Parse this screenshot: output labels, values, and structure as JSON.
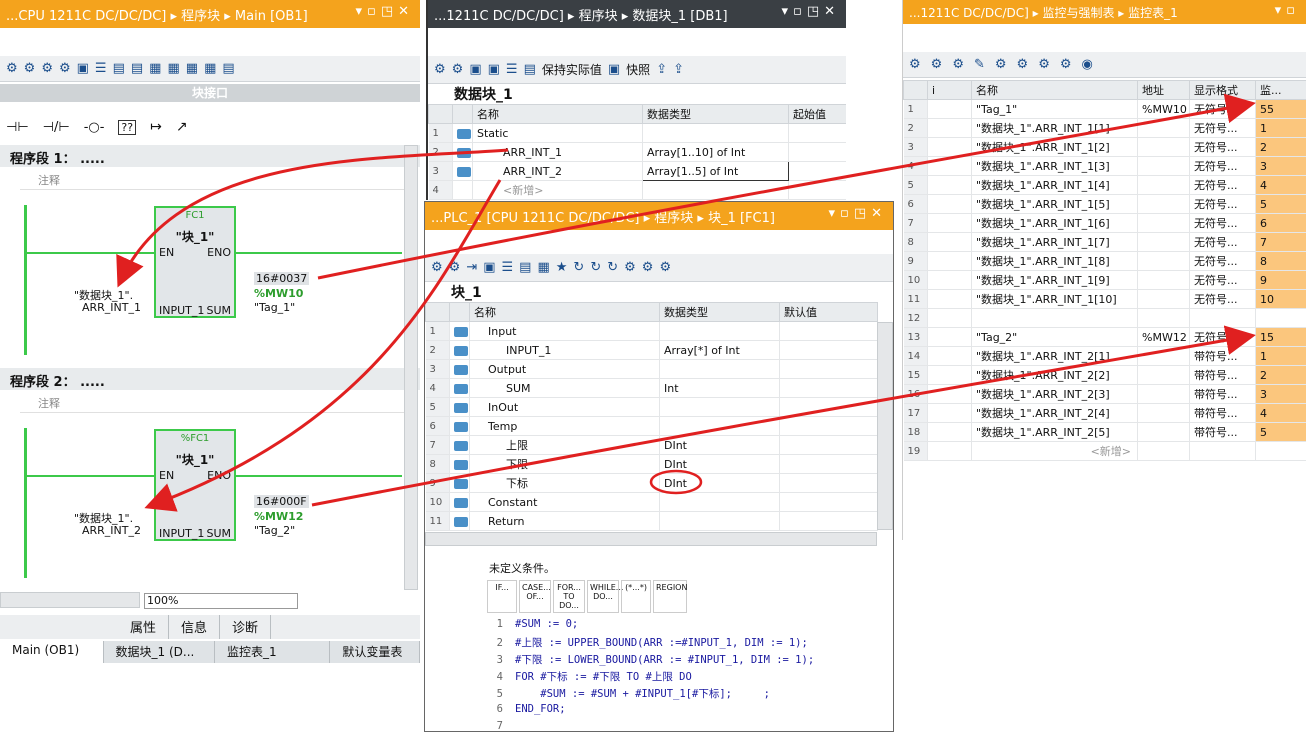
{
  "ob1": {
    "title": "...CPU 1211C DC/DC/DC] ▸ 程序块 ▸ Main [OB1]",
    "interface_bar": "块接口",
    "ladder_toolbar": [
      "⊣⊢",
      "⊣/⊢",
      "-○-",
      "??",
      "↦",
      "↗"
    ],
    "networks": [
      {
        "label": "程序段 1：  .....",
        "comment": "注释",
        "block_type": "FC1",
        "block_name": "\"块_1\"",
        "en": "EN",
        "eno": "ENO",
        "input_pin": "INPUT_1",
        "sum_pin": "SUM",
        "input_operand_1": "\"数据块_1\".",
        "input_operand_2": "ARR_INT_1",
        "out_hex": "16#0037",
        "out_addr": "%MW10",
        "out_tag": "\"Tag_1\""
      },
      {
        "label": "程序段 2：  .....",
        "comment": "注释",
        "block_type": "%FC1",
        "block_name": "\"块_1\"",
        "en": "EN",
        "eno": "ENO",
        "input_pin": "INPUT_1",
        "sum_pin": "SUM",
        "input_operand_1": "\"数据块_1\".",
        "input_operand_2": "ARR_INT_2",
        "out_hex": "16#000F",
        "out_addr": "%MW12",
        "out_tag": "\"Tag_2\""
      }
    ],
    "zoom": "100%",
    "bottom_tabs": [
      "属性",
      "信息",
      "诊断"
    ],
    "taskbar": [
      "Main (OB1)",
      "数据块_1 (D...",
      "监控表_1",
      "默认变量表"
    ]
  },
  "db1": {
    "title": "...1211C DC/DC/DC] ▸ 程序块 ▸ 数据块_1 [DB1]",
    "toolbar": {
      "keep_actual": "保持实际值",
      "snapshot": "快照"
    },
    "heading": "数据块_1",
    "columns": [
      "名称",
      "数据类型",
      "起始值"
    ],
    "rows": [
      {
        "n": "1",
        "name": "Static",
        "type": ""
      },
      {
        "n": "2",
        "name": "ARR_INT_1",
        "type": "Array[1..10] of Int"
      },
      {
        "n": "3",
        "name": "ARR_INT_2",
        "type": "Array[1..5] of Int"
      },
      {
        "n": "4",
        "name": "<新增>",
        "type": ""
      }
    ]
  },
  "fc1": {
    "title": "...PLC_1 [CPU 1211C DC/DC/DC] ▸ 程序块 ▸ 块_1 [FC1]",
    "heading": "块_1",
    "columns": [
      "名称",
      "数据类型",
      "默认值"
    ],
    "rows": [
      {
        "n": "1",
        "name": "Input",
        "type": ""
      },
      {
        "n": "2",
        "name": "INPUT_1",
        "type": "Array[*] of Int"
      },
      {
        "n": "3",
        "name": "Output",
        "type": ""
      },
      {
        "n": "4",
        "name": "SUM",
        "type": "Int"
      },
      {
        "n": "5",
        "name": "InOut",
        "type": ""
      },
      {
        "n": "6",
        "name": "Temp",
        "type": ""
      },
      {
        "n": "7",
        "name": "上限",
        "type": "DInt"
      },
      {
        "n": "8",
        "name": "下限",
        "type": "DInt"
      },
      {
        "n": "9",
        "name": "下标",
        "type": "DInt"
      },
      {
        "n": "10",
        "name": "Constant",
        "type": ""
      },
      {
        "n": "11",
        "name": "Return",
        "type": ""
      }
    ],
    "condition": "未定义条件。",
    "scl_buttons": [
      "IF...",
      "CASE... OF...",
      "FOR... TO DO...",
      "WHILE... DO...",
      "(*...*)",
      "REGION"
    ],
    "code": [
      {
        "n": "1",
        "text": "#SUM := 0;"
      },
      {
        "n": "2",
        "text": "#上限 := UPPER_BOUND(ARR :=#INPUT_1, DIM := 1);"
      },
      {
        "n": "3",
        "text": "#下限 := LOWER_BOUND(ARR := #INPUT_1, DIM := 1);"
      },
      {
        "n": "4",
        "text": "FOR #下标 := #下限 TO #上限 DO"
      },
      {
        "n": "5",
        "text": "    #SUM := #SUM + #INPUT_1[#下标];     ;"
      },
      {
        "n": "6",
        "text": "END_FOR;"
      },
      {
        "n": "7",
        "text": ""
      }
    ]
  },
  "watch": {
    "title": "...1211C DC/DC/DC] ▸ 监控与强制表 ▸ 监控表_1",
    "columns": [
      "i",
      "名称",
      "地址",
      "显示格式",
      "监..."
    ],
    "rows": [
      {
        "n": "1",
        "name": "\"Tag_1\"",
        "addr": "%MW10",
        "fmt": "无符号...",
        "val": "55"
      },
      {
        "n": "2",
        "name": "\"数据块_1\".ARR_INT_1[1]",
        "addr": "",
        "fmt": "无符号...",
        "val": "1"
      },
      {
        "n": "3",
        "name": "\"数据块_1\".ARR_INT_1[2]",
        "addr": "",
        "fmt": "无符号...",
        "val": "2"
      },
      {
        "n": "4",
        "name": "\"数据块_1\".ARR_INT_1[3]",
        "addr": "",
        "fmt": "无符号...",
        "val": "3"
      },
      {
        "n": "5",
        "name": "\"数据块_1\".ARR_INT_1[4]",
        "addr": "",
        "fmt": "无符号...",
        "val": "4"
      },
      {
        "n": "6",
        "name": "\"数据块_1\".ARR_INT_1[5]",
        "addr": "",
        "fmt": "无符号...",
        "val": "5"
      },
      {
        "n": "7",
        "name": "\"数据块_1\".ARR_INT_1[6]",
        "addr": "",
        "fmt": "无符号...",
        "val": "6"
      },
      {
        "n": "8",
        "name": "\"数据块_1\".ARR_INT_1[7]",
        "addr": "",
        "fmt": "无符号...",
        "val": "7"
      },
      {
        "n": "9",
        "name": "\"数据块_1\".ARR_INT_1[8]",
        "addr": "",
        "fmt": "无符号...",
        "val": "8"
      },
      {
        "n": "10",
        "name": "\"数据块_1\".ARR_INT_1[9]",
        "addr": "",
        "fmt": "无符号...",
        "val": "9"
      },
      {
        "n": "11",
        "name": "\"数据块_1\".ARR_INT_1[10]",
        "addr": "",
        "fmt": "无符号...",
        "val": "10"
      },
      {
        "n": "12",
        "name": "",
        "addr": "",
        "fmt": "",
        "val": ""
      },
      {
        "n": "13",
        "name": "\"Tag_2\"",
        "addr": "%MW12",
        "fmt": "无符号",
        "val": "15"
      },
      {
        "n": "14",
        "name": "\"数据块_1\".ARR_INT_2[1]",
        "addr": "",
        "fmt": "带符号...",
        "val": "1"
      },
      {
        "n": "15",
        "name": "\"数据块_1\".ARR_INT_2[2]",
        "addr": "",
        "fmt": "带符号...",
        "val": "2"
      },
      {
        "n": "16",
        "name": "\"数据块_1\".ARR_INT_2[3]",
        "addr": "",
        "fmt": "带符号...",
        "val": "3"
      },
      {
        "n": "17",
        "name": "\"数据块_1\".ARR_INT_2[4]",
        "addr": "",
        "fmt": "带符号...",
        "val": "4"
      },
      {
        "n": "18",
        "name": "\"数据块_1\".ARR_INT_2[5]",
        "addr": "",
        "fmt": "带符号...",
        "val": "5"
      },
      {
        "n": "19",
        "name": "<新增>",
        "addr": "",
        "fmt": "",
        "val": ""
      }
    ]
  },
  "colors": {
    "title_bar": "#f4a31d",
    "ladder_green": "#3cc94a",
    "monitor_value": "#fbc67d",
    "annotation_red": "#e02020"
  }
}
